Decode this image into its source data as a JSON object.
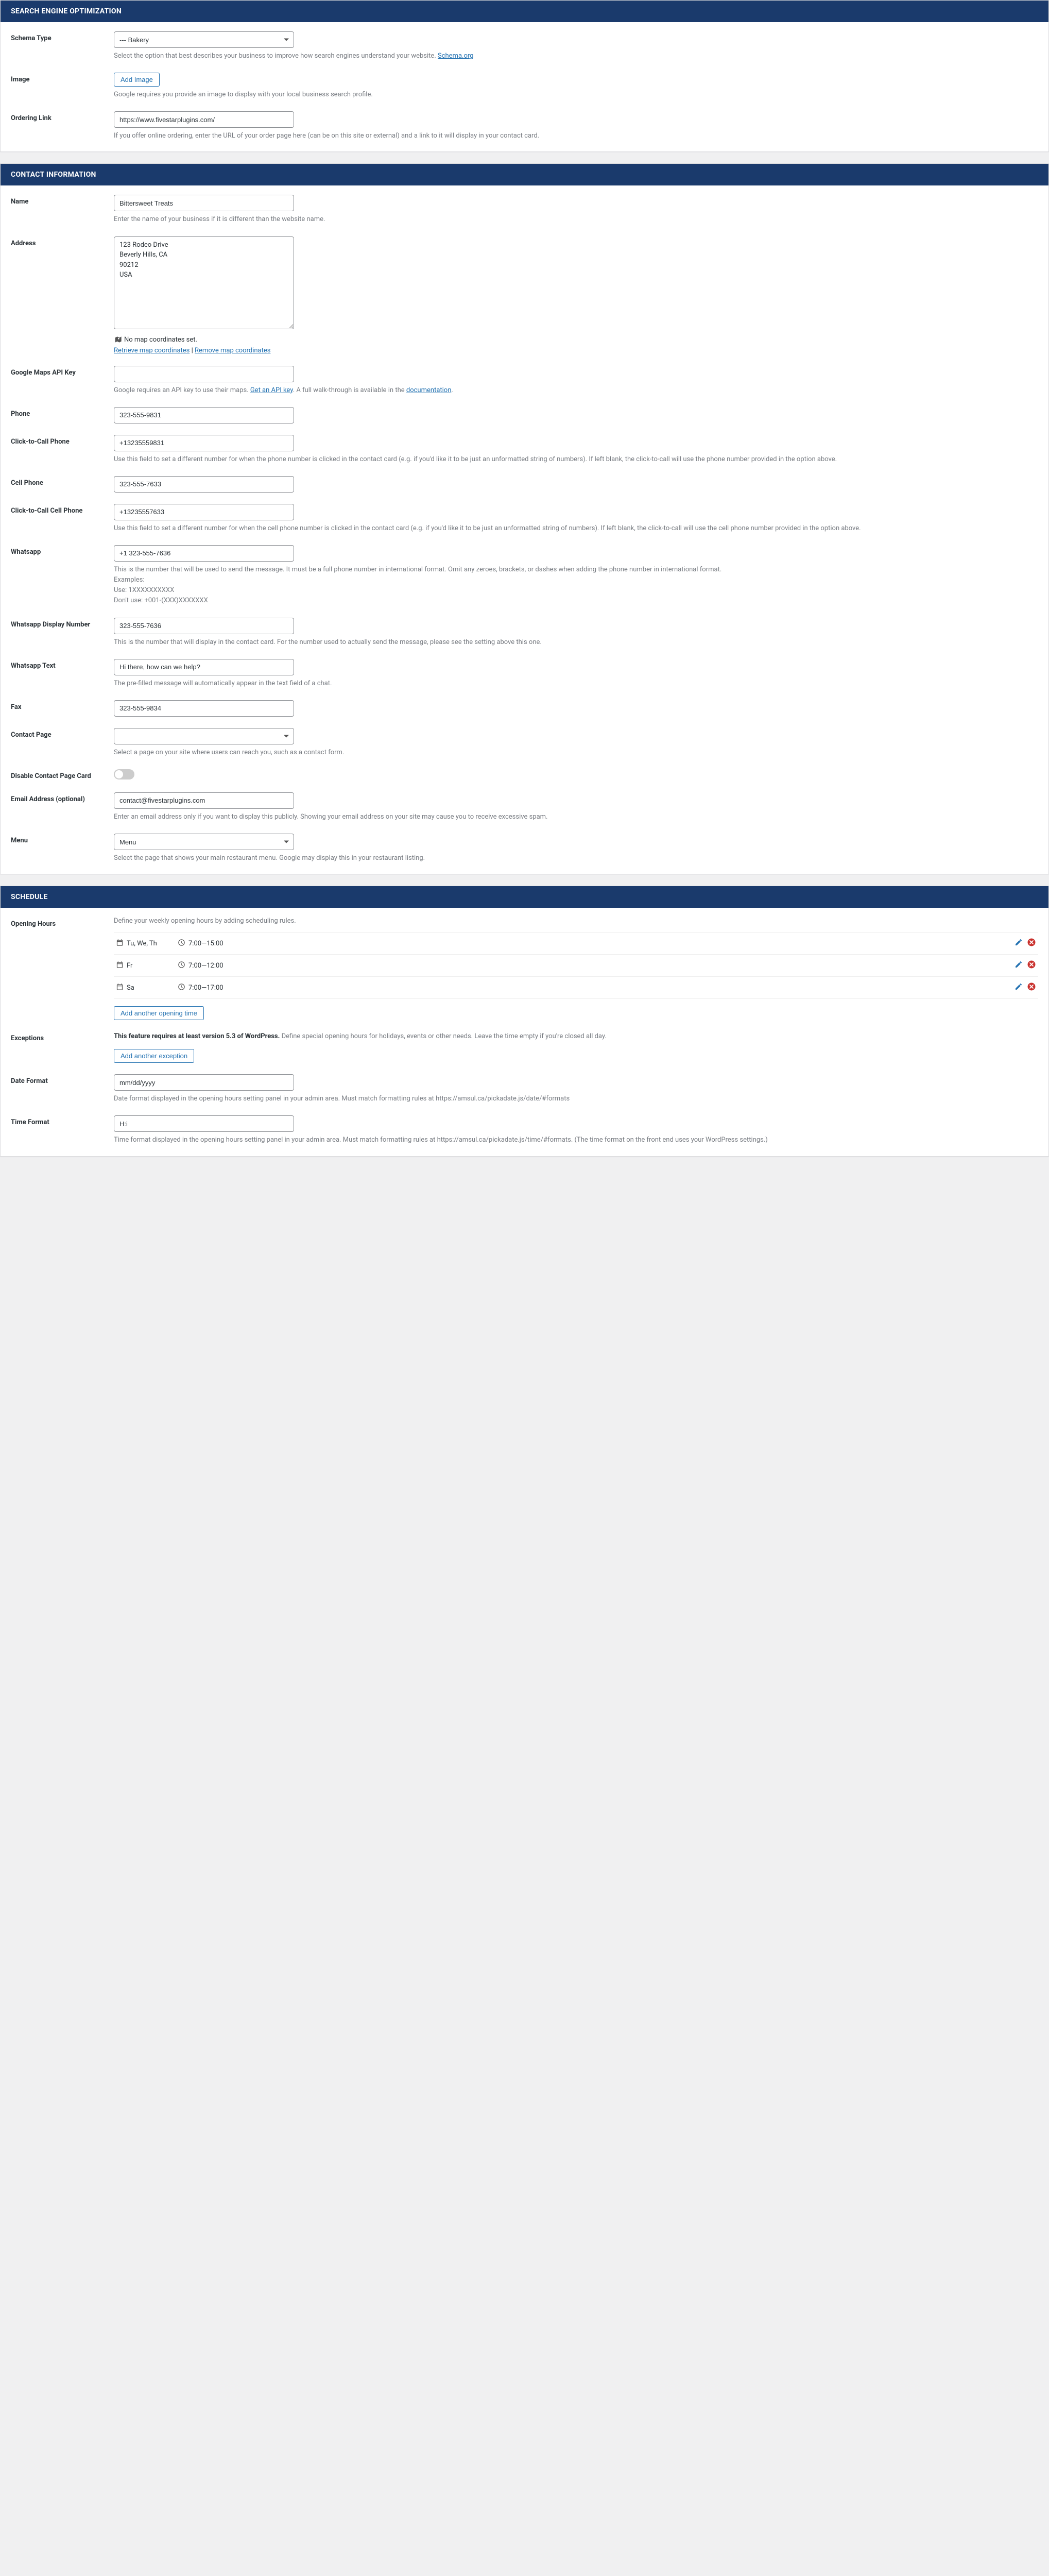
{
  "seo": {
    "header": "SEARCH ENGINE OPTIMIZATION",
    "schema": {
      "label": "Schema Type",
      "value": "--- Bakery",
      "desc_prefix": "Select the option that best describes your business to improve how search engines understand your website. ",
      "link": "Schema.org"
    },
    "image": {
      "label": "Image",
      "button": "Add Image",
      "desc": "Google requires you provide an image to display with your local business search profile."
    },
    "ordering": {
      "label": "Ordering Link",
      "value": "https://www.fivestarplugins.com/",
      "desc": "If you offer online ordering, enter the URL of your order page here (can be on this site or external) and a link to it will display in your contact card."
    }
  },
  "contact": {
    "header": "CONTACT INFORMATION",
    "name": {
      "label": "Name",
      "value": "Bittersweet Treats",
      "desc": "Enter the name of your business if it is different than the website name."
    },
    "address": {
      "label": "Address",
      "value": "123 Rodeo Drive\nBeverly Hills, CA\n90212\nUSA",
      "no_coords": "No map coordinates set.",
      "retrieve": "Retrieve map coordinates",
      "sep": " | ",
      "remove": "Remove map coordinates"
    },
    "gmaps": {
      "label": "Google Maps API Key",
      "value": "",
      "desc_prefix": "Google requires an API key to use their maps. ",
      "link": "Get an API key",
      "desc_mid": ". A full walk-through is available in the ",
      "doc_link": "documentation",
      "desc_suffix": "."
    },
    "phone": {
      "label": "Phone",
      "value": "323-555-9831"
    },
    "ctc_phone": {
      "label": "Click-to-Call Phone",
      "value": "+13235559831",
      "desc": "Use this field to set a different number for when the phone number is clicked in the contact card (e.g. if you'd like it to be just an unformatted string of numbers). If left blank, the click-to-call will use the phone number provided in the option above."
    },
    "cell": {
      "label": "Cell Phone",
      "value": "323-555-7633"
    },
    "ctc_cell": {
      "label": "Click-to-Call Cell Phone",
      "value": "+13235557633",
      "desc": "Use this field to set a different number for when the cell phone number is clicked in the contact card (e.g. if you'd like it to be just an unformatted string of numbers). If left blank, the click-to-call will use the cell phone number provided in the option above."
    },
    "whatsapp": {
      "label": "Whatsapp",
      "value": "+1 323-555-7636",
      "desc": "This is the number that will be used to send the message. It must be a full phone number in international format. Omit any zeroes, brackets, or dashes when adding the phone number in international format.\nExamples:\nUse: 1XXXXXXXXXX\nDon't use: +001-(XXX)XXXXXXX"
    },
    "whatsapp_display": {
      "label": "Whatsapp Display Number",
      "value": "323-555-7636",
      "desc": "This is the number that will display in the contact card. For the number used to actually send the message, please see the setting above this one."
    },
    "whatsapp_text": {
      "label": "Whatsapp Text",
      "value": "Hi there, how can we help?",
      "desc": "The pre-filled message will automatically appear in the text field of a chat."
    },
    "fax": {
      "label": "Fax",
      "value": "323-555-9834"
    },
    "contact_page": {
      "label": "Contact Page",
      "value": "",
      "desc": "Select a page on your site where users can reach you, such as a contact form."
    },
    "disable_card": {
      "label": "Disable Contact Page Card"
    },
    "email": {
      "label": "Email Address (optional)",
      "value": "contact@fivestarplugins.com",
      "desc": "Enter an email address only if you want to display this publicly. Showing your email address on your site may cause you to receive excessive spam."
    },
    "menu": {
      "label": "Menu",
      "value": "Menu",
      "desc": "Select the page that shows your main restaurant menu. Google may display this in your restaurant listing."
    }
  },
  "schedule": {
    "header": "SCHEDULE",
    "opening": {
      "label": "Opening Hours",
      "intro": "Define your weekly opening hours by adding scheduling rules.",
      "rules": [
        {
          "days": "Tu, We, Th",
          "hours": "7:00—15:00"
        },
        {
          "days": "Fr",
          "hours": "7:00—12:00"
        },
        {
          "days": "Sa",
          "hours": "7:00—17:00"
        }
      ],
      "add": "Add another opening time"
    },
    "exceptions": {
      "label": "Exceptions",
      "strong": "This feature requires at least version 5.3 of WordPress.",
      "rest": " Define special opening hours for holidays, events or other needs. Leave the time empty if you're closed all day.",
      "add": "Add another exception"
    },
    "date_format": {
      "label": "Date Format",
      "value": "mm/dd/yyyy",
      "desc": "Date format displayed in the opening hours setting panel in your admin area. Must match formatting rules at https://amsul.ca/pickadate.js/date/#formats"
    },
    "time_format": {
      "label": "Time Format",
      "value": "H:i",
      "desc": "Time format displayed in the opening hours setting panel in your admin area. Must match formatting rules at https://amsul.ca/pickadate.js/time/#formats. (The time format on the front end uses your WordPress settings.)"
    }
  }
}
